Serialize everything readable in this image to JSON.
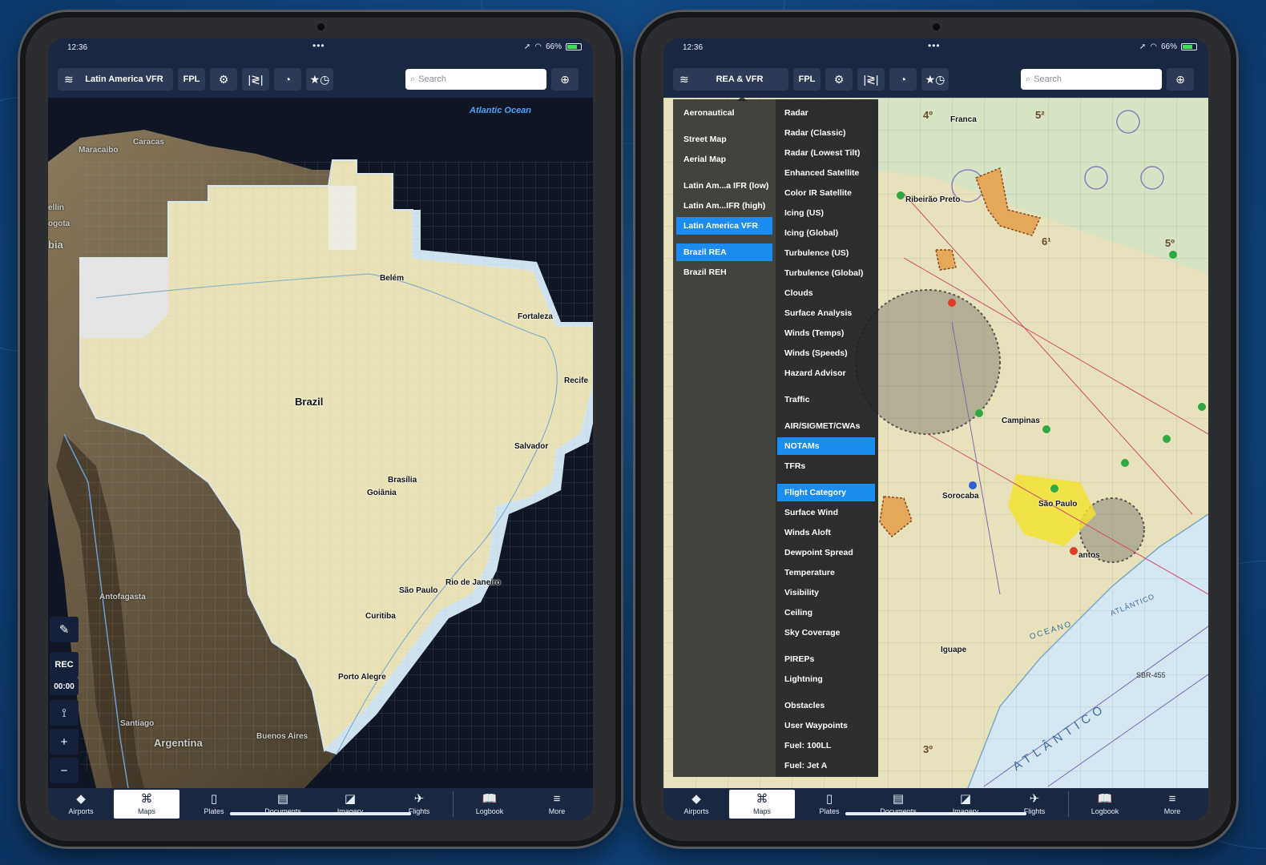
{
  "left": {
    "status": {
      "time": "12:36",
      "dots": "•••",
      "battery": "66%"
    },
    "toolbar": {
      "layers_label": "Latin America VFR",
      "fpl_label": "FPL",
      "search_placeholder": "Search"
    },
    "map": {
      "ocean": "Atlantic Ocean",
      "labels": {
        "caracas": "Caracas",
        "maracaibo": "Maracaibo",
        "medellin": "ellin",
        "bogota": "ogota",
        "colombia": "bia",
        "belem": "Belém",
        "fortaleza": "Fortaleza",
        "recife": "Recife",
        "brazil": "Brazil",
        "salvador": "Salvador",
        "brasilia": "Brasília",
        "goiania": "Goiânia",
        "rio": "Rio de Janeiro",
        "saopaulo": "São Paulo",
        "curitiba": "Curitiba",
        "portoalegre": "Porto Alegre",
        "antofagasta": "Antofagasta",
        "santiago": "Santiago",
        "argentina": "Argentina",
        "buenosaires": "Buenos Aires"
      }
    },
    "tools": {
      "rec": "REC",
      "timer": "00:00"
    }
  },
  "right": {
    "status": {
      "time": "12:36",
      "dots": "•••",
      "battery": "66%"
    },
    "toolbar": {
      "layers_label": "REA & VFR",
      "fpl_label": "FPL",
      "search_placeholder": "Search"
    },
    "map": {
      "labels": {
        "franca": "Franca",
        "ribeirao": "Ribeirão Preto",
        "campinas": "Campinas",
        "sorocaba": "Sorocaba",
        "saopaulo": "São Paulo",
        "santos": "antos",
        "iguape": "Iguape",
        "oceano": "OCEANO",
        "atlantico_small": "ATLÂNTICO",
        "atlantico_big": "ATLÂNTICO",
        "sbr": "SBR-455",
        "deg3": "3º",
        "deg4": "4º",
        "deg5": "5º",
        "deg5b": "5²",
        "deg6": "6¹"
      }
    },
    "menu": {
      "base_maps": [
        {
          "label": "Aeronautical",
          "selected": false
        },
        {
          "label": "Street Map",
          "selected": false
        },
        {
          "label": "Aerial Map",
          "selected": false
        },
        {
          "label": "Latin Am...a IFR (low)",
          "selected": false
        },
        {
          "label": "Latin Am...IFR (high)",
          "selected": false
        },
        {
          "label": "Latin America VFR",
          "selected": true
        },
        {
          "label": "Brazil REA",
          "selected": true
        },
        {
          "label": "Brazil REH",
          "selected": false
        }
      ],
      "overlays": [
        {
          "label": "Radar",
          "selected": false
        },
        {
          "label": "Radar (Classic)",
          "selected": false
        },
        {
          "label": "Radar (Lowest Tilt)",
          "selected": false
        },
        {
          "label": "Enhanced Satellite",
          "selected": false
        },
        {
          "label": "Color IR Satellite",
          "selected": false
        },
        {
          "label": "Icing (US)",
          "selected": false
        },
        {
          "label": "Icing (Global)",
          "selected": false
        },
        {
          "label": "Turbulence (US)",
          "selected": false
        },
        {
          "label": "Turbulence (Global)",
          "selected": false
        },
        {
          "label": "Clouds",
          "selected": false
        },
        {
          "label": "Surface Analysis",
          "selected": false
        },
        {
          "label": "Winds (Temps)",
          "selected": false
        },
        {
          "label": "Winds (Speeds)",
          "selected": false
        },
        {
          "label": "Hazard Advisor",
          "selected": false
        },
        {
          "label": "Traffic",
          "selected": false
        },
        {
          "label": "AIR/SIGMET/CWAs",
          "selected": false
        },
        {
          "label": "NOTAMs",
          "selected": true
        },
        {
          "label": "TFRs",
          "selected": false
        },
        {
          "label": "Flight Category",
          "selected": true
        },
        {
          "label": "Surface Wind",
          "selected": false
        },
        {
          "label": "Winds Aloft",
          "selected": false
        },
        {
          "label": "Dewpoint Spread",
          "selected": false
        },
        {
          "label": "Temperature",
          "selected": false
        },
        {
          "label": "Visibility",
          "selected": false
        },
        {
          "label": "Ceiling",
          "selected": false
        },
        {
          "label": "Sky Coverage",
          "selected": false
        },
        {
          "label": "PIREPs",
          "selected": false
        },
        {
          "label": "Lightning",
          "selected": false
        },
        {
          "label": "Obstacles",
          "selected": false
        },
        {
          "label": "User Waypoints",
          "selected": false
        },
        {
          "label": "Fuel: 100LL",
          "selected": false
        },
        {
          "label": "Fuel: Jet A",
          "selected": false
        }
      ]
    }
  },
  "tabs": [
    {
      "label": "Airports",
      "icon": "airports-icon"
    },
    {
      "label": "Maps",
      "icon": "maps-icon"
    },
    {
      "label": "Plates",
      "icon": "plates-icon"
    },
    {
      "label": "Documents",
      "icon": "documents-icon"
    },
    {
      "label": "Imagery",
      "icon": "imagery-icon"
    },
    {
      "label": "Flights",
      "icon": "flights-icon"
    },
    {
      "label": "Logbook",
      "icon": "logbook-icon"
    },
    {
      "label": "More",
      "icon": "more-icon"
    }
  ],
  "active_tab": "Maps",
  "colors": {
    "toolbar": "#1a2740",
    "selected": "#1c8df0",
    "chart_vfr": "#e9e2b6"
  }
}
